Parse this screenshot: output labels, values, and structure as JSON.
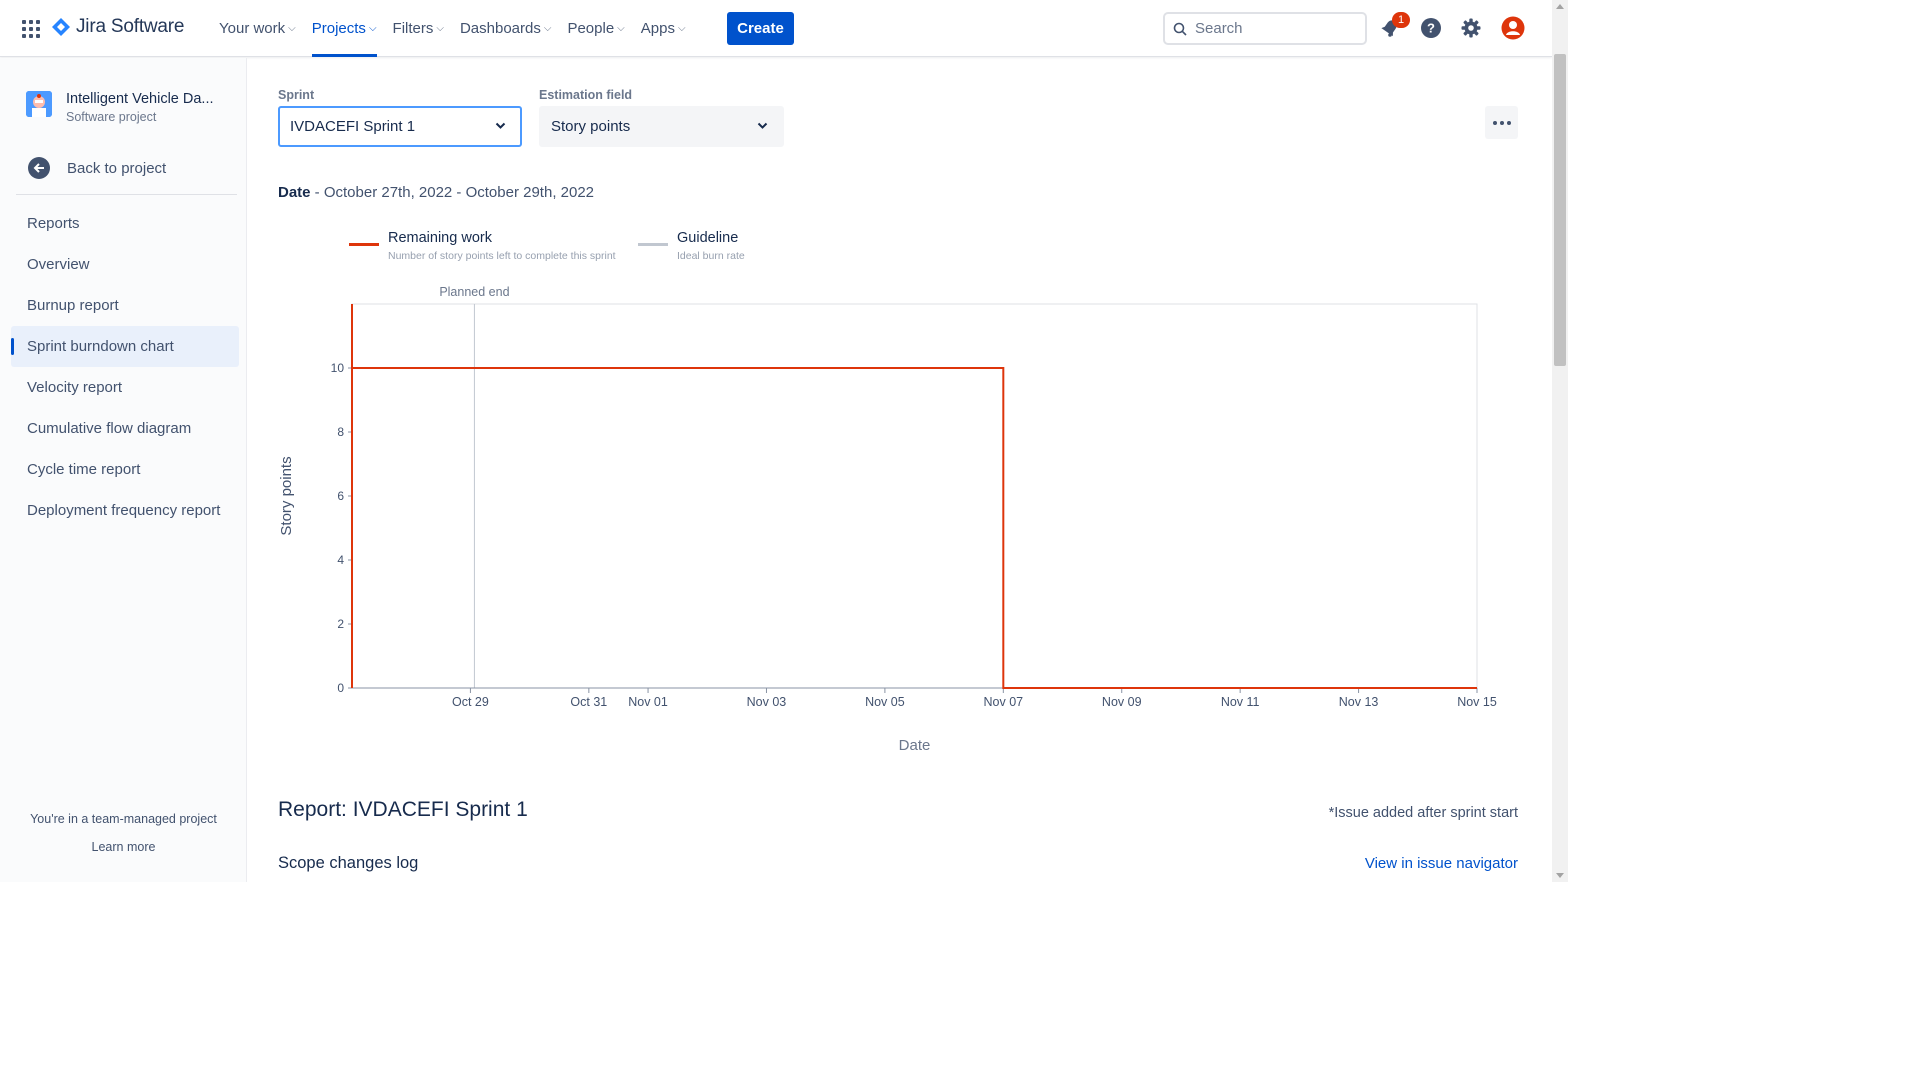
{
  "app": {
    "name": "Jira Software"
  },
  "nav": {
    "items": [
      {
        "label": "Your work",
        "active": false
      },
      {
        "label": "Projects",
        "active": true
      },
      {
        "label": "Filters",
        "active": false
      },
      {
        "label": "Dashboards",
        "active": false
      },
      {
        "label": "People",
        "active": false
      },
      {
        "label": "Apps",
        "active": false
      }
    ],
    "create_label": "Create"
  },
  "search": {
    "placeholder": "Search"
  },
  "notifications": {
    "count": "1"
  },
  "sidebar": {
    "project_name": "Intelligent Vehicle Da...",
    "project_type": "Software project",
    "back_label": "Back to project",
    "heading": "Reports",
    "items": [
      {
        "label": "Overview",
        "active": false
      },
      {
        "label": "Burnup report",
        "active": false
      },
      {
        "label": "Sprint burndown chart",
        "active": true
      },
      {
        "label": "Velocity report",
        "active": false
      },
      {
        "label": "Cumulative flow diagram",
        "active": false
      },
      {
        "label": "Cycle time report",
        "active": false
      },
      {
        "label": "Deployment frequency report",
        "active": false
      }
    ],
    "footer_text": "You're in a team-managed project",
    "footer_link": "Learn more"
  },
  "filters": {
    "sprint_label": "Sprint",
    "sprint_value": "IVDACEFI Sprint 1",
    "estimation_label": "Estimation field",
    "estimation_value": "Story points"
  },
  "date_info": {
    "label": "Date",
    "range": " - October 27th, 2022 - October 29th, 2022"
  },
  "legend": [
    {
      "title": "Remaining work",
      "desc": "Number of story points left to complete this sprint",
      "color": "#de350b"
    },
    {
      "title": "Guideline",
      "desc": "Ideal burn rate",
      "color": "#c1c7d0"
    }
  ],
  "chart_data": {
    "type": "line",
    "ylabel": "Story points",
    "xlabel": "Date",
    "ylim": [
      0,
      12
    ],
    "yticks": [
      0,
      2,
      4,
      6,
      8,
      10
    ],
    "xlim": [
      "2022-10-27",
      "2022-11-15"
    ],
    "xticks": [
      "Oct 29",
      "Oct 31",
      "Nov 01",
      "Nov 03",
      "Nov 05",
      "Nov 07",
      "Nov 09",
      "Nov 11",
      "Nov 13",
      "Nov 15"
    ],
    "annotations": [
      {
        "label": "Planned end",
        "x": "2022-10-29"
      }
    ],
    "series": [
      {
        "name": "Remaining work",
        "color": "#de350b",
        "points": [
          {
            "x": "2022-10-27",
            "y": 0
          },
          {
            "x": "2022-10-27",
            "y": 12
          },
          {
            "x": "2022-10-27",
            "y": 10
          },
          {
            "x": "2022-11-07",
            "y": 10
          },
          {
            "x": "2022-11-07",
            "y": 0
          },
          {
            "x": "2022-11-15",
            "y": 0
          }
        ]
      }
    ],
    "grid": false
  },
  "report": {
    "title": "Report: IVDACEFI Sprint 1",
    "note": "*Issue added after sprint start",
    "scope_log": "Scope changes log",
    "view_link": "View in issue navigator"
  }
}
